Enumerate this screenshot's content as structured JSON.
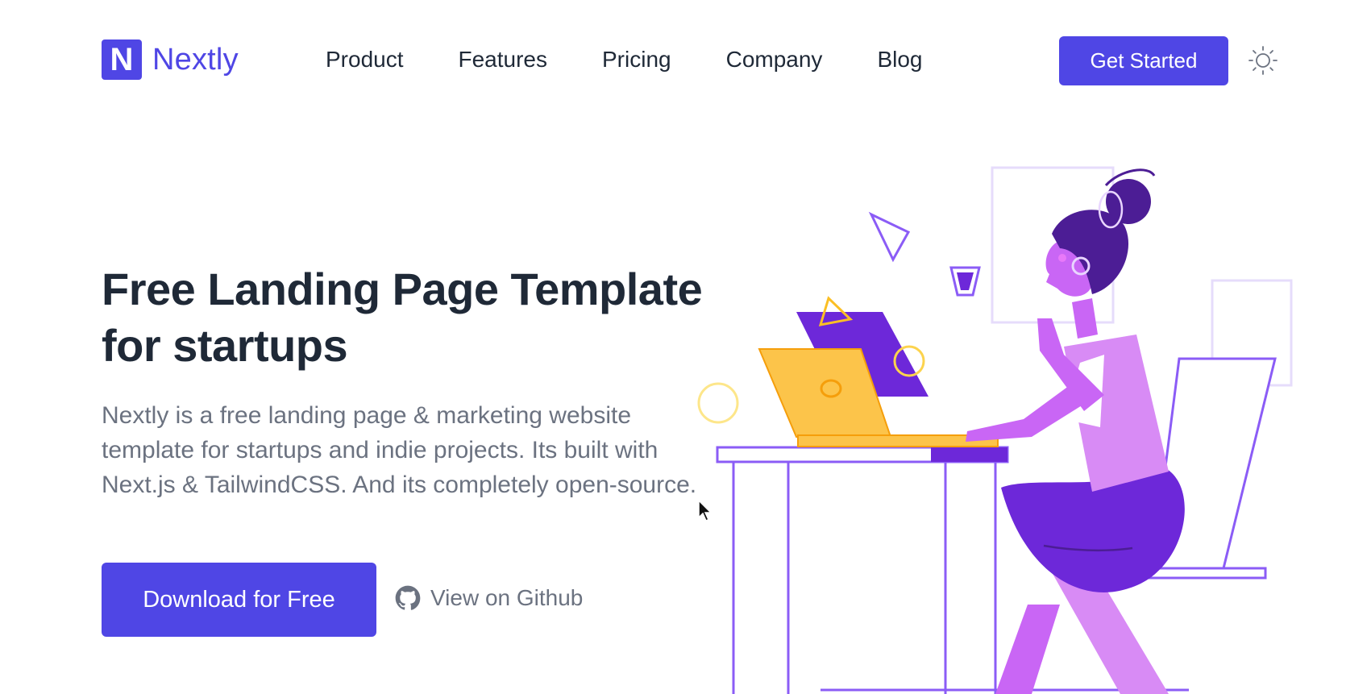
{
  "brand": {
    "logo_letter": "N",
    "name": "Nextly"
  },
  "nav": {
    "items": [
      {
        "label": "Product"
      },
      {
        "label": "Features"
      },
      {
        "label": "Pricing"
      },
      {
        "label": "Company"
      },
      {
        "label": "Blog"
      }
    ],
    "cta_label": "Get Started",
    "theme_icon": "sun-icon"
  },
  "hero": {
    "title": "Free Landing Page Template for startups",
    "description": "Nextly is a free landing page & marketing website template for startups and indie projects. Its built with Next.js & TailwindCSS. And its completely open-source.",
    "primary_button": "Download for Free",
    "secondary_button": "View on Github",
    "secondary_icon": "github-icon"
  },
  "colors": {
    "accent": "#4f46e5",
    "heading": "#1f2937",
    "body_text": "#6b7280",
    "illustration_purple": "#7c3aed",
    "illustration_pink": "#d88bf5",
    "illustration_yellow": "#fcc44a"
  }
}
